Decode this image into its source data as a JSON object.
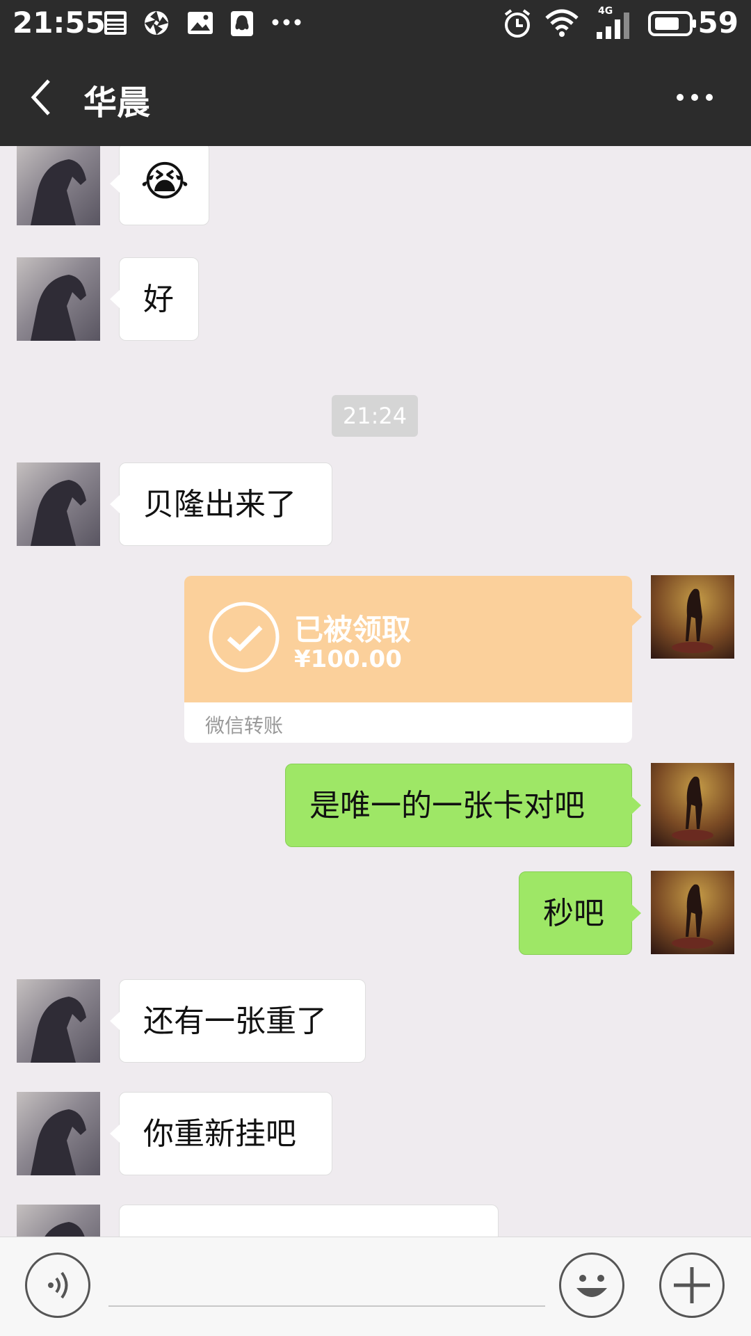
{
  "status_bar": {
    "time": "21:55",
    "notification_icons": [
      "news-icon",
      "aperture-icon",
      "image-icon",
      "qq-icon",
      "more-notifications-icon"
    ],
    "right_icons": [
      "alarm-icon",
      "wifi-icon",
      "signal-4g-icon",
      "battery-icon"
    ],
    "network_label": "4G",
    "battery_level": "59"
  },
  "header": {
    "title": "华晨",
    "back_icon": "chevron-left-icon",
    "menu_icon": "more-horizontal-icon"
  },
  "timestamp": "21:24",
  "messages": [
    {
      "side": "in",
      "type": "emoji",
      "text": "😭"
    },
    {
      "side": "in",
      "type": "text",
      "text": "好"
    },
    {
      "side": "in",
      "type": "text",
      "text": "贝隆出来了"
    },
    {
      "side": "out",
      "type": "transfer",
      "status": "已被领取",
      "amount": "¥100.00",
      "label": "微信转账"
    },
    {
      "side": "out",
      "type": "text",
      "text": "是唯一的一张卡对吧"
    },
    {
      "side": "out",
      "type": "text",
      "text": "秒吧"
    },
    {
      "side": "in",
      "type": "text",
      "text": "还有一张重了"
    },
    {
      "side": "in",
      "type": "text",
      "text": "你重新挂吧"
    },
    {
      "side": "in",
      "type": "text",
      "text": ""
    }
  ],
  "input_bar": {
    "voice_icon": "voice-icon",
    "emoji_icon": "emoji-icon",
    "plus_icon": "plus-icon",
    "input_value": ""
  },
  "colors": {
    "bar": "#2c2c2c",
    "chat_background": "#efebef",
    "incoming_bubble": "#ffffff",
    "outgoing_bubble": "#9ee766",
    "transfer_card": "#fbd09b"
  }
}
